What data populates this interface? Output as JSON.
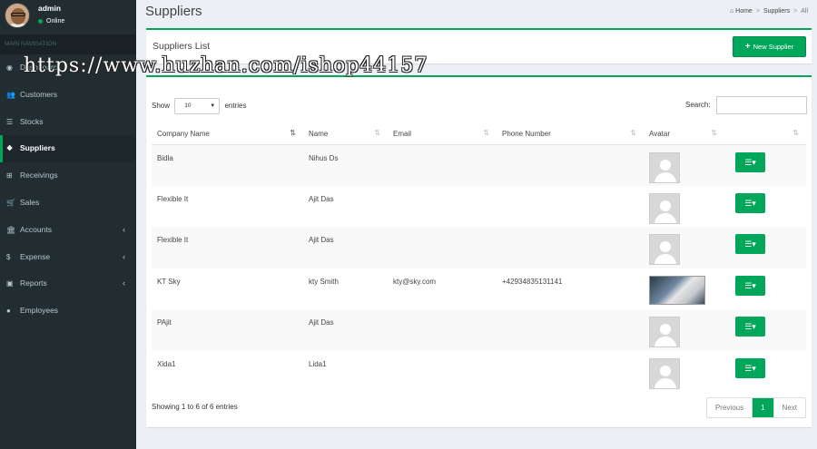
{
  "user": {
    "name": "admin",
    "status": "Online"
  },
  "sidebar": {
    "header": "MAIN NAVIGATION",
    "items": [
      {
        "label": "Dashboard",
        "icon": "dashboard-icon",
        "glyph": "◉",
        "caret": ""
      },
      {
        "label": "Customers",
        "icon": "users-icon",
        "glyph": "👥",
        "caret": ""
      },
      {
        "label": "Stocks",
        "icon": "list-icon",
        "glyph": "☰",
        "caret": ""
      },
      {
        "label": "Suppliers",
        "icon": "cubes-icon",
        "glyph": "❖",
        "caret": ""
      },
      {
        "label": "Receivings",
        "icon": "sitemap-icon",
        "glyph": "⊞",
        "caret": ""
      },
      {
        "label": "Sales",
        "icon": "cart-icon",
        "glyph": "🛒",
        "caret": ""
      },
      {
        "label": "Accounts",
        "icon": "bank-icon",
        "glyph": "🏛",
        "caret": "‹"
      },
      {
        "label": "Expense",
        "icon": "dollar-icon",
        "glyph": "$",
        "caret": "‹"
      },
      {
        "label": "Reports",
        "icon": "money-icon",
        "glyph": "▣",
        "caret": "‹"
      },
      {
        "label": "Employees",
        "icon": "user-icon",
        "glyph": "●",
        "caret": ""
      }
    ]
  },
  "page": {
    "title": "Suppliers"
  },
  "breadcrumb": {
    "home": "Home",
    "section": "Suppliers",
    "current": "All"
  },
  "box": {
    "title": "Suppliers List",
    "new_button": "New Supplier"
  },
  "table_controls": {
    "show_label": "Show",
    "entries_value": "10",
    "entries_label": "entries",
    "search_label": "Search:",
    "search_value": ""
  },
  "table": {
    "headers": [
      "Company Name",
      "Name",
      "Email",
      "Phone Number",
      "Avatar",
      ""
    ],
    "rows": [
      {
        "company": "Bidla",
        "name": "Nihus Ds",
        "email": "",
        "phone": "",
        "avatar": "placeholder"
      },
      {
        "company": "Flexible It",
        "name": "Ajit Das",
        "email": "",
        "phone": "",
        "avatar": "placeholder"
      },
      {
        "company": "Flexible It",
        "name": "Ajit Das",
        "email": "",
        "phone": "",
        "avatar": "placeholder"
      },
      {
        "company": "KT Sky",
        "name": "kty Smith",
        "email": "kty@sky.com",
        "phone": "+42934835131141",
        "avatar": "photo"
      },
      {
        "company": "PAjit",
        "name": "Ajit Das",
        "email": "",
        "phone": "",
        "avatar": "placeholder"
      },
      {
        "company": "Xida1",
        "name": "Lida1",
        "email": "",
        "phone": "",
        "avatar": "placeholder"
      }
    ]
  },
  "footer": {
    "info": "Showing 1 to 6 of 6 entries",
    "prev": "Previous",
    "page": "1",
    "next": "Next"
  },
  "watermark": "https://www.huzhan.com/ishop44157",
  "colors": {
    "accent": "#00a65a",
    "sidebar": "#222d32",
    "background": "#ecf0f5"
  }
}
